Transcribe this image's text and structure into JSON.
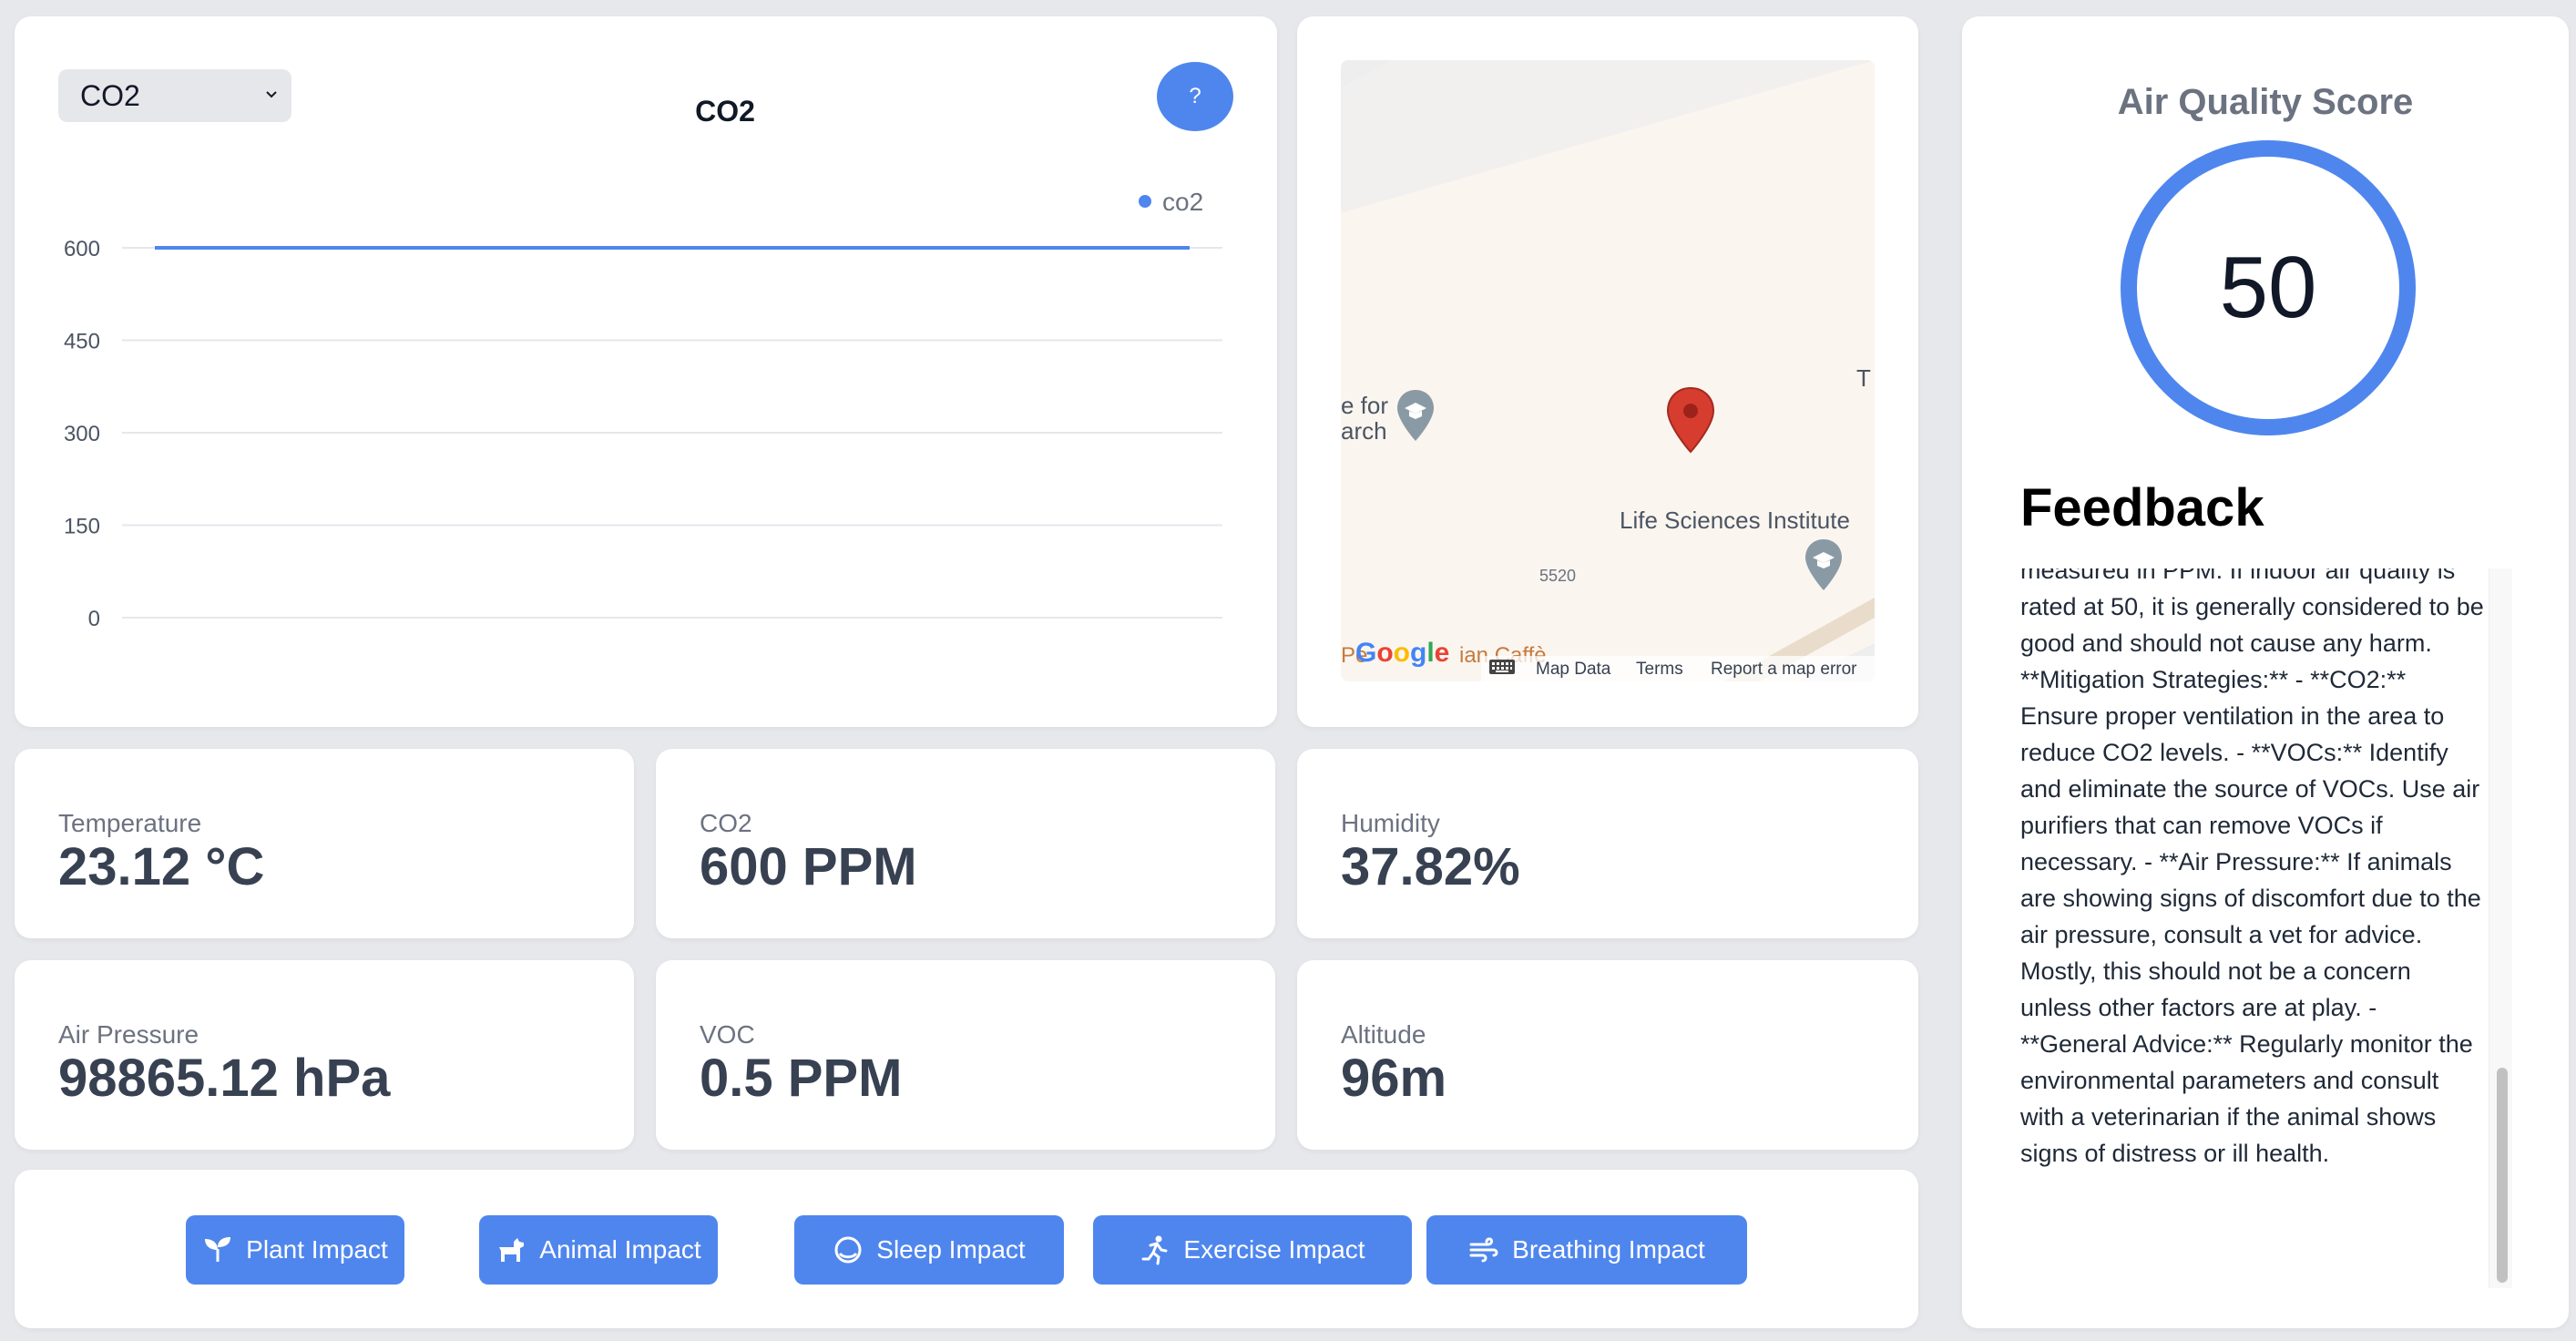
{
  "chart_panel": {
    "selected_metric": "CO2",
    "title": "CO2",
    "help_label": "?"
  },
  "chart_data": {
    "type": "line",
    "title": "CO2",
    "ylim": [
      0,
      600
    ],
    "yticks": [
      0,
      150,
      300,
      450,
      600
    ],
    "series": [
      {
        "name": "co2",
        "values": [
          600,
          600
        ]
      }
    ],
    "legend": "top-right",
    "grid": true,
    "color": "#4f86ee"
  },
  "map": {
    "label_institute": "Life Sciences Institute",
    "label_left_1": "e for",
    "label_left_2": "arch",
    "label_t": "T",
    "number": "5520",
    "bottom_left_text": "Pe",
    "bottom_text": "ian Caffè",
    "logo": "Google",
    "map_data": "Map Data",
    "terms": "Terms",
    "report": "Report a map error",
    "pin_color": "#d63d2f"
  },
  "stats": [
    {
      "label": "Temperature",
      "value": "23.12 °C"
    },
    {
      "label": "CO2",
      "value": "600 PPM"
    },
    {
      "label": "Humidity",
      "value": "37.82%"
    },
    {
      "label": "Air Pressure",
      "value": "98865.12 hPa"
    },
    {
      "label": "VOC",
      "value": "0.5 PPM"
    },
    {
      "label": "Altitude",
      "value": "96m"
    }
  ],
  "impacts": [
    {
      "label": "Plant Impact",
      "icon": "seedling-icon"
    },
    {
      "label": "Animal Impact",
      "icon": "dog-icon"
    },
    {
      "label": "Sleep Impact",
      "icon": "moon-icon"
    },
    {
      "label": "Exercise Impact",
      "icon": "running-icon"
    },
    {
      "label": "Breathing Impact",
      "icon": "wind-icon"
    }
  ],
  "score": {
    "title": "Air Quality Score",
    "value": "50",
    "level": 0.5
  },
  "feedback": {
    "title": "Feedback",
    "text": "measured in PPM. If indoor air quality is rated at 50, it is generally considered to be good and should not cause any harm. **Mitigation Strategies:** - **CO2:** Ensure proper ventilation in the area to reduce CO2 levels. - **VOCs:** Identify and eliminate the source of VOCs. Use air purifiers that can remove VOCs if necessary. - **Air Pressure:** If animals are showing signs of discomfort due to the air pressure, consult a vet for advice. Mostly, this should not be a concern unless other factors are at play. - **General Advice:** Regularly monitor the environmental parameters and consult with a veterinarian if the animal shows signs of distress or ill health."
  },
  "colors": {
    "accent": "#4f86ee",
    "background": "#e7e8ec",
    "card": "#ffffff"
  }
}
